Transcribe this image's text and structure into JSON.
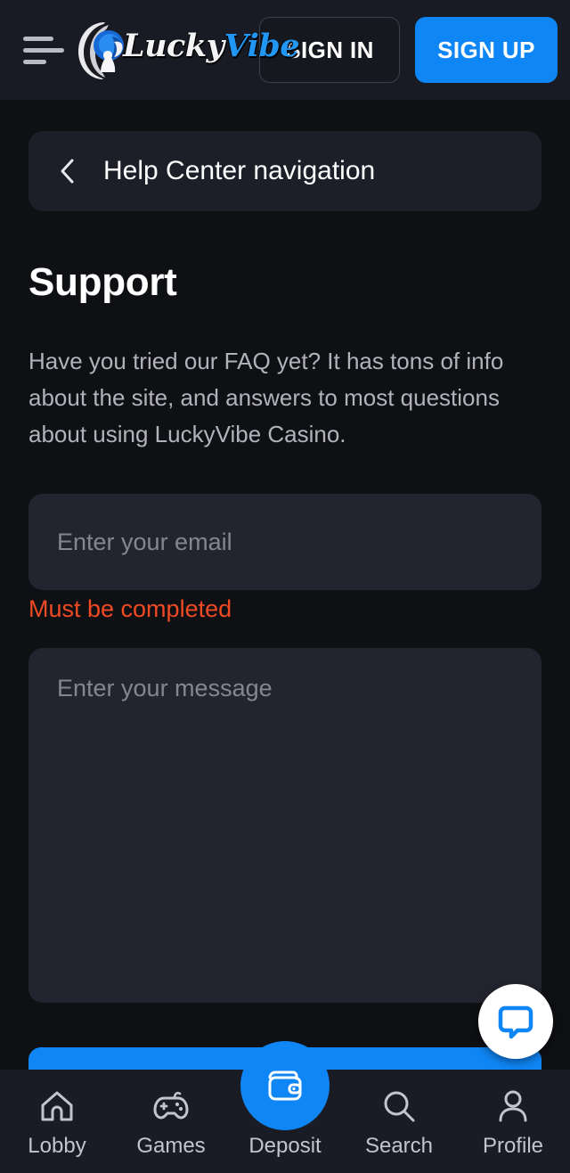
{
  "header": {
    "menu_icon": "hamburger-menu-icon",
    "logo": {
      "name": "luckyvibe-logo",
      "text_primary": "Lucky",
      "text_secondary": "Vibe"
    },
    "sign_in_label": "SIGN IN",
    "sign_up_label": "SIGN UP"
  },
  "nav_card": {
    "back_icon": "chevron-left-icon",
    "title": "Help Center navigation"
  },
  "main": {
    "title": "Support",
    "description": "Have you tried our FAQ yet? It has tons of info about the site, and answers to most questions about using LuckyVibe Casino.",
    "form": {
      "email": {
        "placeholder": "Enter your email",
        "value": "",
        "error": "Must be completed"
      },
      "message": {
        "placeholder": "Enter your message",
        "value": ""
      },
      "submit_label": ""
    }
  },
  "chat_widget": {
    "icon": "chat-bubble-icon",
    "label": ""
  },
  "bottom_nav": {
    "items": [
      {
        "label": "Lobby",
        "icon": "home-icon",
        "active": false
      },
      {
        "label": "Games",
        "icon": "gamepad-icon",
        "active": false
      },
      {
        "label": "Deposit",
        "icon": "wallet-icon",
        "active": true
      },
      {
        "label": "Search",
        "icon": "search-icon",
        "active": false
      },
      {
        "label": "Profile",
        "icon": "user-icon",
        "active": false
      }
    ]
  },
  "colors": {
    "page_background": "#0f1014",
    "header_background": "#191b24",
    "card_background": "#1c1e28",
    "input_background": "#23242f",
    "accent_blue": "#0f86f5",
    "error_red": "#f04a24",
    "nav_background": "#1a1c25",
    "text_primary": "#ffffff",
    "text_muted": "#b2b3ba",
    "placeholder": "#85868f"
  }
}
